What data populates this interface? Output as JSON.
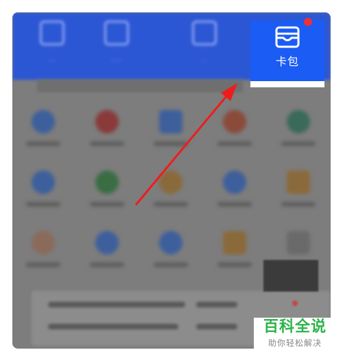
{
  "wallet": {
    "label": "卡包"
  },
  "watermark": {
    "title": "百科全说",
    "subtitle": "助你轻松解决"
  },
  "colors": {
    "highlight": "#1b5cf5",
    "arrow": "#ee1c1c",
    "badge": "#e8313a",
    "watermark": "#2db34b"
  },
  "icons": [
    "wallet-icon",
    "arrow-pointer"
  ]
}
